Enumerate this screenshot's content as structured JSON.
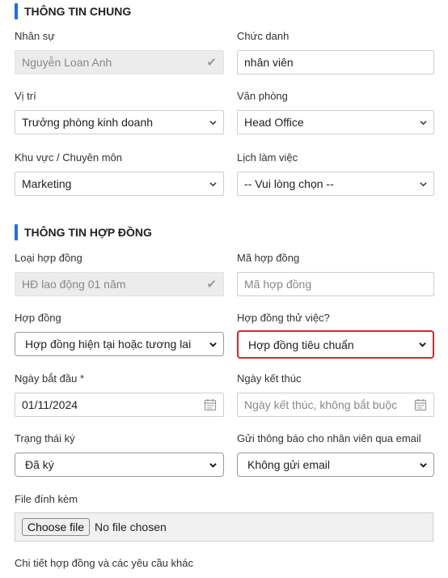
{
  "general_section": {
    "title": "THÔNG TIN CHUNG"
  },
  "employee": {
    "label": "Nhân sự",
    "value": "Nguyễn Loan Anh"
  },
  "job_title": {
    "label": "Chức danh",
    "value": "nhân viên"
  },
  "position": {
    "label": "Vị trí",
    "value": "Trưởng phòng kinh doanh"
  },
  "office": {
    "label": "Văn phòng",
    "value": "Head Office"
  },
  "area": {
    "label": "Khu vực / Chuyên môn",
    "value": "Marketing"
  },
  "schedule": {
    "label": "Lịch làm việc",
    "value": "-- Vui lòng chọn --"
  },
  "contract_section": {
    "title": "THÔNG TIN HỢP ĐỒNG"
  },
  "contract_type": {
    "label": "Loại hợp đồng",
    "value": "HĐ lao động 01 năm"
  },
  "contract_code": {
    "label": "Mã hợp đồng",
    "placeholder": "Mã hợp đồng"
  },
  "contract": {
    "label": "Hợp đồng",
    "value": "Hợp đồng hiện tại hoặc tương lai"
  },
  "probation": {
    "label": "Hợp đồng thử việc?",
    "value": "Hợp đồng tiêu chuẩn"
  },
  "start_date": {
    "label": "Ngày bắt đầu *",
    "value": "01/11/2024"
  },
  "end_date": {
    "label": "Ngày kết thúc",
    "placeholder": "Ngày kết thúc, không bắt buộc"
  },
  "sign_status": {
    "label": "Trạng thái ký",
    "value": "Đã ký"
  },
  "notify": {
    "label": "Gửi thông báo cho nhân viên qua email",
    "value": "Không gửi email"
  },
  "attachment": {
    "label": "File đính kèm",
    "button": "Choose file",
    "status": "No file chosen"
  },
  "details": {
    "label": "Chi tiết hợp đồng và các yêu cầu khác"
  },
  "colors": {
    "accent": "#1e6ee6",
    "highlight": "#d9232e"
  }
}
